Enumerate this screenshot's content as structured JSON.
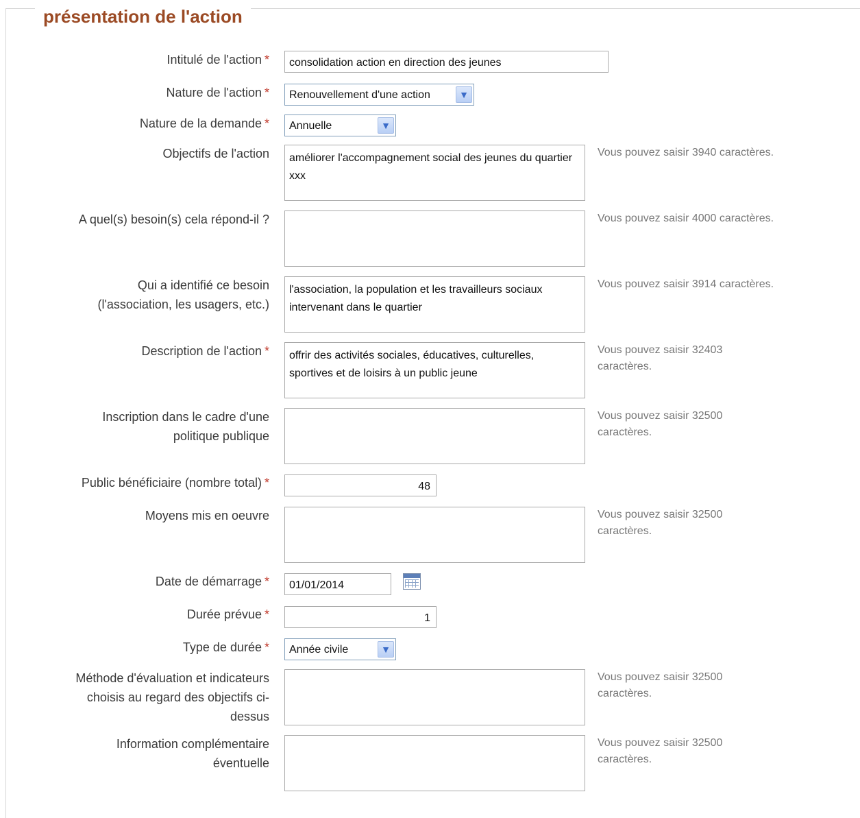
{
  "section_title": "présentation de l'action",
  "required_marker": "*",
  "colors": {
    "title": "#9b4a24",
    "required": "#c0392b",
    "hint": "#777777"
  },
  "fields": {
    "intitule": {
      "label": "Intitulé de l'action",
      "value": "consolidation action en direction des jeunes"
    },
    "nature_action": {
      "label": "Nature de l'action",
      "value": "Renouvellement d'une action"
    },
    "nature_demande": {
      "label": "Nature de la demande",
      "value": "Annuelle"
    },
    "objectifs": {
      "label": "Objectifs de l'action",
      "value": "améliorer l'accompagnement social des jeunes du quartier xxx",
      "hint": "Vous pouvez saisir 3940 caractères."
    },
    "besoins": {
      "label": "A quel(s) besoin(s) cela répond-il ?",
      "value": "",
      "hint": "Vous pouvez saisir 4000 caractères."
    },
    "identifie": {
      "label_line1": "Qui a identifié ce besoin",
      "label_line2": "(l'association, les usagers, etc.)",
      "value": "l'association, la population  et les travailleurs sociaux intervenant dans le quartier",
      "hint": "Vous pouvez saisir 3914 caractères."
    },
    "description": {
      "label": "Description de l'action",
      "value": "offrir des activités sociales, éducatives, culturelles, sportives et de loisirs à un public jeune",
      "hint": "Vous pouvez saisir 32403 caractères."
    },
    "inscription": {
      "label_line1": "Inscription dans le cadre d'une",
      "label_line2": "politique publique",
      "value": "",
      "hint": "Vous pouvez saisir 32500 caractères."
    },
    "public": {
      "label": "Public bénéficiaire (nombre total)",
      "value": "48"
    },
    "moyens": {
      "label": "Moyens mis en oeuvre",
      "value": "",
      "hint": "Vous pouvez saisir 32500 caractères."
    },
    "date_demarrage": {
      "label": "Date de démarrage",
      "value": "01/01/2014"
    },
    "duree": {
      "label": "Durée prévue",
      "value": "1"
    },
    "type_duree": {
      "label": "Type de durée",
      "value": "Année civile"
    },
    "methode": {
      "label_line1": "Méthode d'évaluation et indicateurs",
      "label_line2": "choisis au regard des objectifs ci-",
      "label_line3": "dessus",
      "value": "",
      "hint": "Vous pouvez saisir 32500 caractères."
    },
    "information": {
      "label_line1": "Information complémentaire",
      "label_line2": "éventuelle",
      "value": "",
      "hint": "Vous pouvez saisir 32500 caractères."
    }
  },
  "icons": {
    "dropdown": "chevron-down-icon",
    "calendar": "calendar-icon"
  }
}
